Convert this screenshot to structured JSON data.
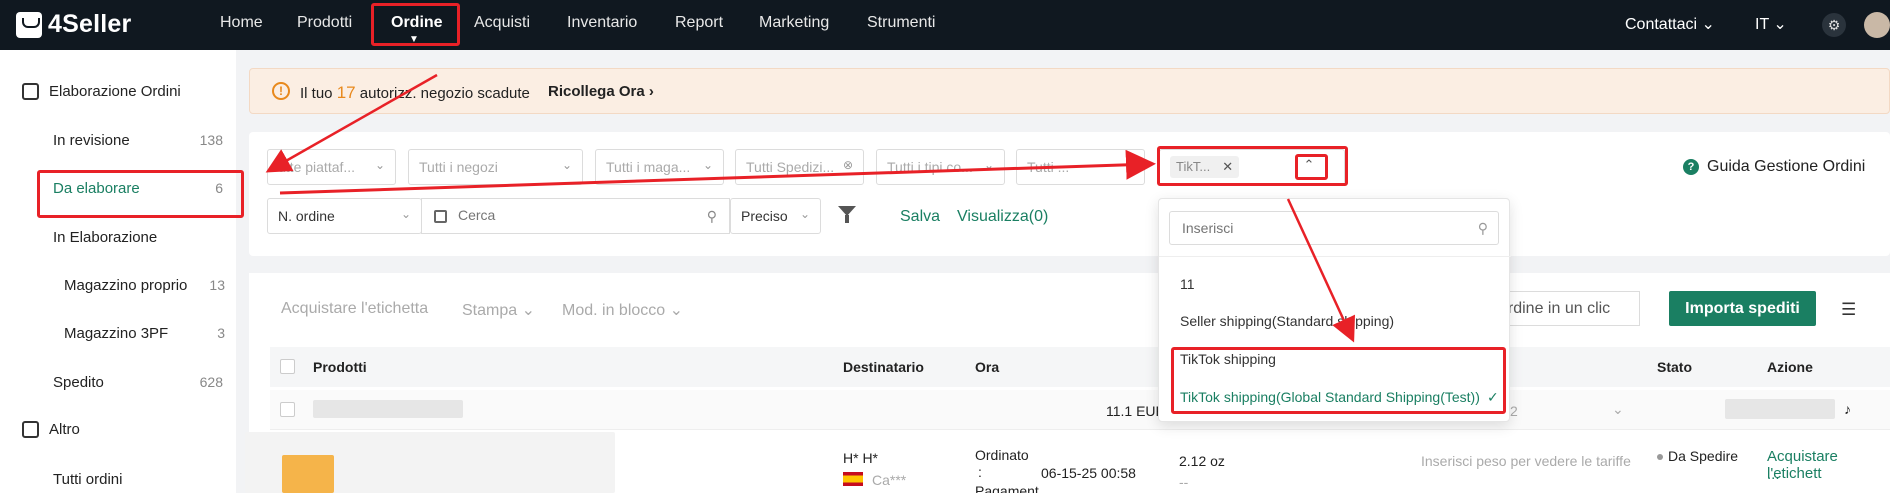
{
  "nav": {
    "brand": "4Seller",
    "items": [
      "Home",
      "Prodotti",
      "Ordine",
      "Acquisti",
      "Inventario",
      "Report",
      "Marketing",
      "Strumenti"
    ],
    "active": "Ordine",
    "contact": "Contattaci",
    "language": "IT"
  },
  "sidebar": {
    "group1": "Elaborazione Ordini",
    "items": [
      {
        "label": "In revisione",
        "count": "138"
      },
      {
        "label": "Da elaborare",
        "count": "6"
      },
      {
        "label": "In Elaborazione",
        "count": ""
      },
      {
        "label": "Magazzino proprio",
        "count": "13"
      },
      {
        "label": "Magazzino 3PF",
        "count": "3"
      },
      {
        "label": "Spedito",
        "count": "628"
      }
    ],
    "group2": "Altro",
    "item_all": "Tutti ordini"
  },
  "alert": {
    "prefix": "Il tuo",
    "count": "17",
    "suffix": "autorizz. negozio scadute",
    "action": "Ricollega Ora"
  },
  "filters": {
    "platform": "utte piattaf...",
    "shops": "Tutti i negozi",
    "warehouse": "Tutti i maga...",
    "shipping": "Tutti Spedizi...",
    "types": "Tutti i tipi co...",
    "extra": "Tutti ...",
    "tag": "TikT...",
    "guide": "Guida Gestione Ordini"
  },
  "search": {
    "field": "N. ordine",
    "placeholder": "Cerca",
    "mode": "Preciso",
    "save": "Salva",
    "view": "Visualizza(0)"
  },
  "toolbar": {
    "buy_label": "Acquistare l'etichetta",
    "print": "Stampa",
    "bulk": "Mod. in blocco",
    "one_click": "i ordine in un clic",
    "import": "Importa spediti"
  },
  "table": {
    "headers": {
      "products": "Prodotti",
      "recipient": "Destinatario",
      "time": "Ora",
      "status": "Stato",
      "action": "Azione"
    },
    "group_amount": "11.1 EUR",
    "group_right": "2",
    "row": {
      "recipient_name": "H* H*",
      "recipient_city": "Ca***",
      "ordered_label": "Ordinato",
      "colon": ":",
      "ordered_time": "06-15-25 00:58",
      "payment_label": "Pagament",
      "weight": "2.12 oz",
      "weight_sub": "--",
      "rate_hint": "Inserisci peso per vedere le tariffe",
      "status": "Da Spedire",
      "action": "Acquistare l'etichett",
      "action_more": "..."
    }
  },
  "dropdown": {
    "placeholder": "Inserisci",
    "options": [
      "11",
      "Seller shipping(Standard shipping)",
      "TikTok shipping",
      "TikTok shipping(Global Standard Shipping(Test))"
    ],
    "selected_index": 3
  },
  "colors": {
    "nav_bg": "#101820",
    "accent": "#1a7f62",
    "warning": "#e8891d",
    "annotation": "#e82127"
  }
}
